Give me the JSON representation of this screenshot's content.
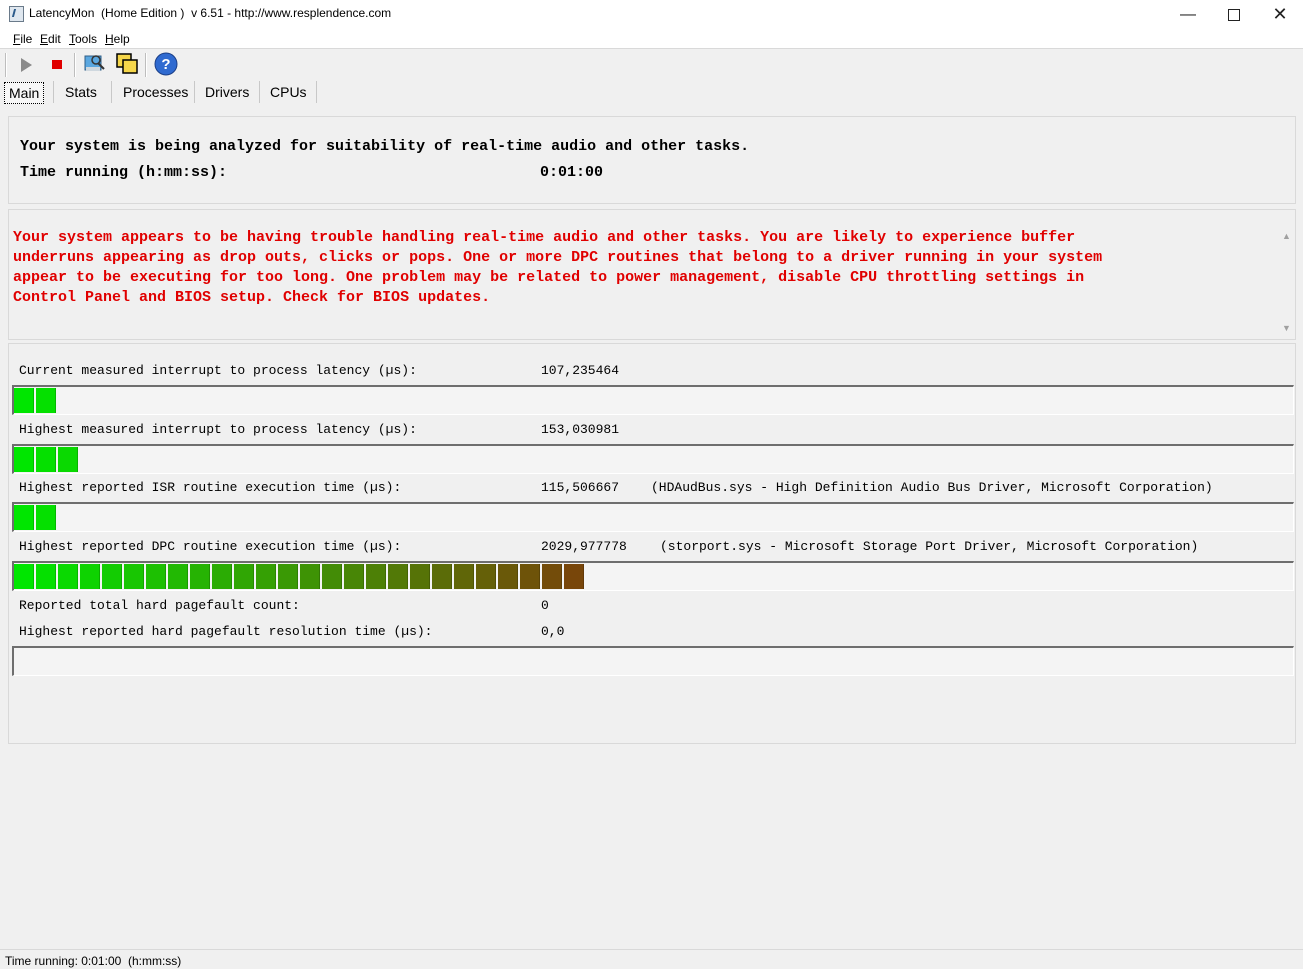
{
  "window": {
    "title": "LatencyMon  (Home Edition )  v 6.51 - http://www.resplendence.com",
    "controls": [
      "minimize-icon",
      "maximize-icon",
      "close-icon"
    ]
  },
  "menu": [
    "File",
    "Edit",
    "Tools",
    "Help"
  ],
  "toolbar": {
    "icons": [
      "play-icon",
      "stop-icon",
      "search-drivers-icon",
      "windows-icon",
      "help-icon"
    ]
  },
  "tabs": [
    "Main",
    "Stats",
    "Processes",
    "Drivers",
    "CPUs"
  ],
  "summary": {
    "analyzing": "Your system is being analyzed for suitability of real-time audio and other tasks.",
    "time_label": "Time running (h:mm:ss):",
    "time_value": "0:01:00"
  },
  "message": {
    "text": "Your system appears to be having trouble handling real-time audio and other tasks. You are likely to experience buffer\nunderruns appearing as drop outs, clicks or pops. One or more DPC routines that belong to a driver running in your system\nappear to be executing for too long. One problem may be related to power management, disable CPU throttling settings in\nControl Panel and BIOS setup. Check for BIOS updates.",
    "color": "#e00000"
  },
  "stats": [
    {
      "label": "Current measured interrupt to process latency (µs):",
      "value": "107,235464",
      "driver": "",
      "segments": 2
    },
    {
      "label": "Highest measured interrupt to process latency (µs):",
      "value": "153,030981",
      "driver": "",
      "segments": 3
    },
    {
      "label": "Highest reported ISR routine execution time (µs):",
      "value": "115,506667",
      "driver": "(HDAudBus.sys - High Definition Audio Bus Driver, Microsoft Corporation)",
      "segments": 2
    },
    {
      "label": "Highest reported DPC routine execution time (µs):",
      "value": "2029,977778",
      "driver": "(storport.sys - Microsoft Storage Port Driver, Microsoft Corporation)",
      "segments": 26
    }
  ],
  "pagefault": {
    "count_label": "Reported total hard pagefault count:",
    "count_value": "0",
    "time_label": "Highest reported hard pagefault resolution time (µs):",
    "time_value": "0,0",
    "segments": 0
  },
  "statusbar": "Time running: 0:01:00  (h:mm:ss)"
}
